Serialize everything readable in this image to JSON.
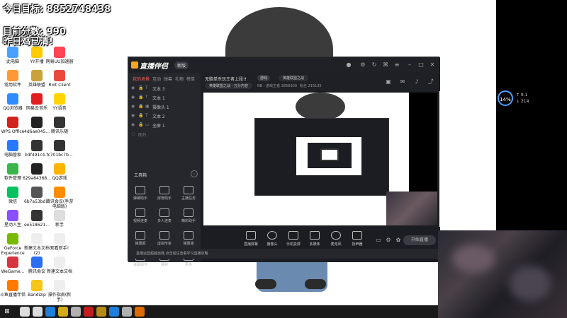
{
  "overlay": {
    "line1_prefix": "今日目标:",
    "line1_number": "8852748438",
    "line2_label": "目前分数:",
    "line2_value": "990",
    "line3": "昨日鸡已清!"
  },
  "desktop_icons": [
    {
      "label": "此电脑",
      "color": "#4aa0ff"
    },
    {
      "label": "YY开播",
      "color": "#ffcc00"
    },
    {
      "label": "网易UU加速器",
      "color": "#ff4455"
    },
    {
      "label": "常用软件",
      "color": "#ff9933"
    },
    {
      "label": "英雄联盟",
      "color": "#c9a23c"
    },
    {
      "label": "Riot Client",
      "color": "#e84a3c"
    },
    {
      "label": "QQ浏览器",
      "color": "#2f8cff"
    },
    {
      "label": "网易云音乐",
      "color": "#e02020"
    },
    {
      "label": "YY语音",
      "color": "#ffd400"
    },
    {
      "label": "WPS Office",
      "color": "#d0221f"
    },
    {
      "label": "4d6ae045...",
      "color": "#222222"
    },
    {
      "label": "腾讯乐随",
      "color": "#333333"
    },
    {
      "label": "电脑管家",
      "color": "#2979ff"
    },
    {
      "label": "b4f491c4...",
      "color": "#333333"
    },
    {
      "label": "fc701bc7b...",
      "color": "#333333"
    },
    {
      "label": "软件管理",
      "color": "#3bb44a"
    },
    {
      "label": "629a84368...",
      "color": "#222222"
    },
    {
      "label": "QQ游戏",
      "color": "#ffb400"
    },
    {
      "label": "微信",
      "color": "#07c160"
    },
    {
      "label": "6b7a53bd...",
      "color": "#555555"
    },
    {
      "label": "腾讯会议(手游电脑版)",
      "color": "#ff8c00"
    },
    {
      "label": "星动人生",
      "color": "#8a4fff"
    },
    {
      "label": "ee518621...",
      "color": "#333333"
    },
    {
      "label": "新手",
      "color": "#dddddd"
    },
    {
      "label": "GeForce Experience",
      "color": "#76b900"
    },
    {
      "label": "新建文本文档(2)",
      "color": "#eeeeee"
    },
    {
      "label": "观看新手!",
      "color": "#eeeeee"
    },
    {
      "label": "WeGame...",
      "color": "#d4373e"
    },
    {
      "label": "腾讯会议",
      "color": "#2b6ef2"
    },
    {
      "label": "新建文本文档",
      "color": "#eeeeee"
    },
    {
      "label": "斗鱼直播伴侣",
      "color": "#ff7a00"
    },
    {
      "label": "Bandizip",
      "color": "#f5c518"
    },
    {
      "label": "操作指南(新手)",
      "color": "#eeeeee"
    }
  ],
  "app": {
    "title": "直播伴侣",
    "version": "新版",
    "sidebar_tabs": [
      "我的场景",
      "互动",
      "弹幕",
      "礼物",
      "榜单"
    ],
    "scenes": [
      "文本 3",
      "文本 1",
      "摄像头 1",
      "文本 2",
      "全屏 1",
      "图片"
    ],
    "tools_title": "工具箱",
    "tools": [
      "弹幕助手",
      "房管助手",
      "主播任务",
      "视频连麦",
      "多人连麦",
      "精彩助手",
      "弹幕姬",
      "虚拟形象",
      "弹幕墙",
      "弹幕组件",
      "福利",
      "更多"
    ],
    "room": {
      "title": "无脑单杀玩王者上段!!",
      "category": "游戏",
      "game": "英雄联盟之战",
      "game2": "英雄联盟之战 - 万分内容",
      "id": "NB - 游戏王者 2856300",
      "fans": "粉丝 215135"
    },
    "bottom_tools": [
      "直播屏幕",
      "摄像头",
      "手机投屏",
      "多媒体",
      "麦克风",
      "扬声器"
    ],
    "start_button": "开始直播",
    "notice": "直播运营超越自我,点击前往查看学习直播攻略"
  },
  "net_widget": {
    "value": "14",
    "unit": "%",
    "up": "↑ 9.1",
    "down": "↓ 214"
  },
  "taskbar_icons": [
    {
      "name": "search",
      "color": "#ffffff"
    },
    {
      "name": "task-view",
      "color": "#ffffff"
    },
    {
      "name": "edge",
      "color": "#1e90ff"
    },
    {
      "name": "explorer",
      "color": "#f5c518"
    },
    {
      "name": "app1",
      "color": "#cccccc"
    },
    {
      "name": "netease",
      "color": "#e02020"
    },
    {
      "name": "app2",
      "color": "#d4a017"
    },
    {
      "name": "chrome",
      "color": "#1e90ff"
    },
    {
      "name": "app3",
      "color": "#cccccc"
    },
    {
      "name": "douyu",
      "color": "#ff7a00"
    }
  ]
}
